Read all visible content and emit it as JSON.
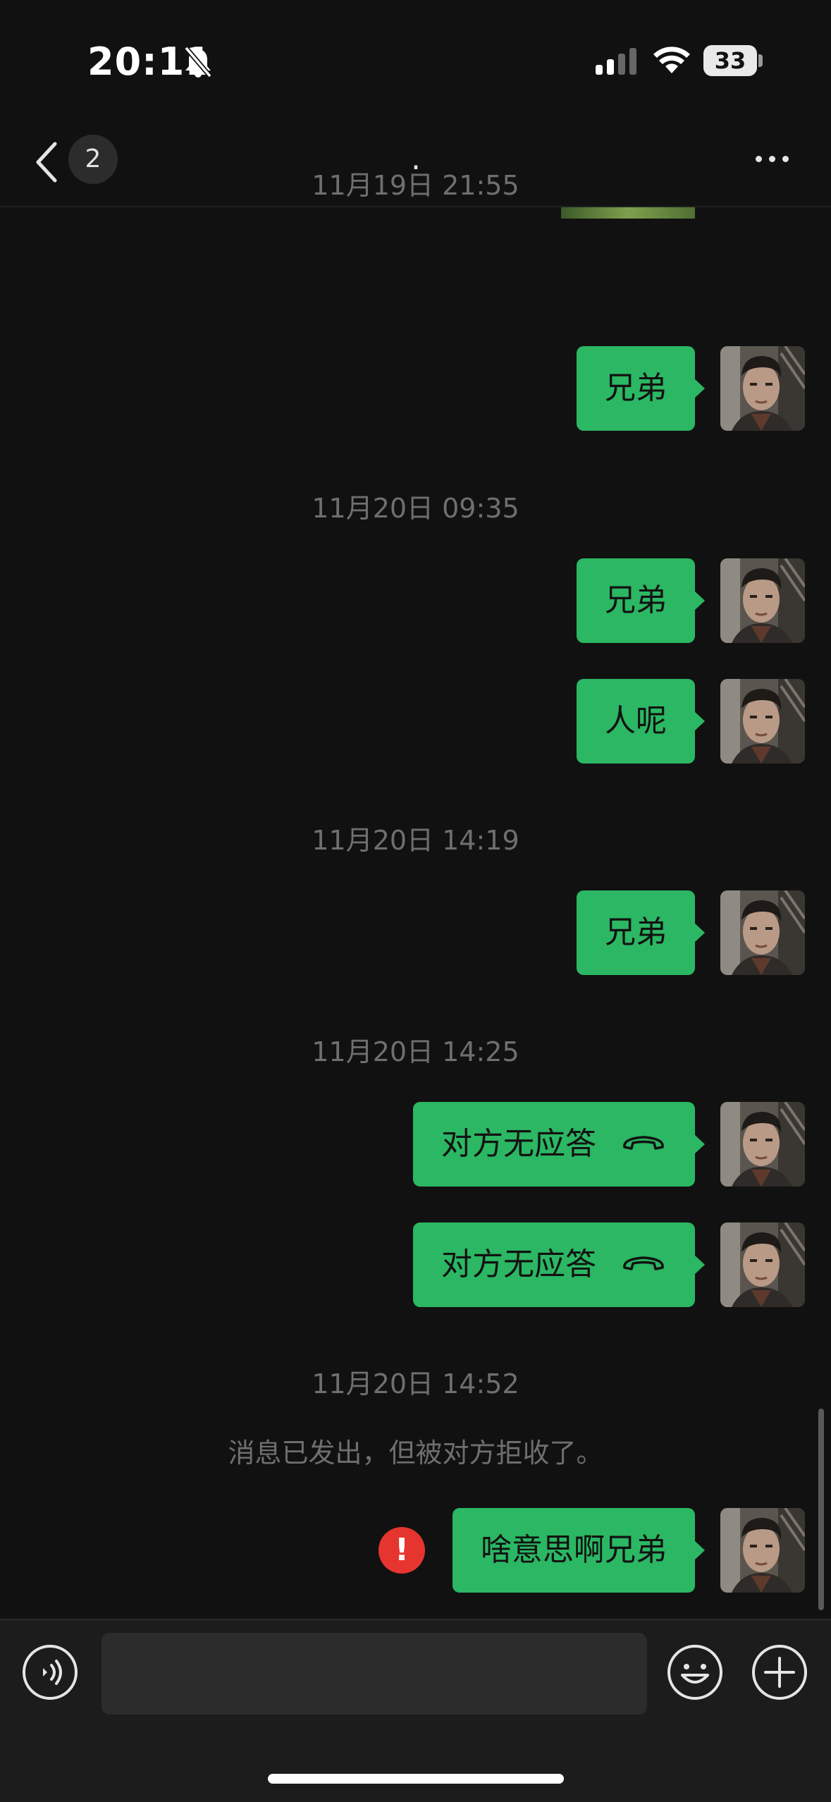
{
  "status_bar": {
    "time": "20:11",
    "battery": "33"
  },
  "nav": {
    "unread_count": "2",
    "title": "."
  },
  "chat": {
    "timestamps": [
      "11月19日 21:55",
      "11月20日 09:35",
      "11月20日 14:19",
      "11月20日 14:25",
      "11月20日 14:52"
    ],
    "messages": [
      {
        "text": "兄弟"
      },
      {
        "text": "兄弟"
      },
      {
        "text": "人呢"
      },
      {
        "text": "兄弟"
      },
      {
        "text": "对方无应答",
        "icon": "phone-hangup-icon"
      },
      {
        "text": "对方无应答",
        "icon": "phone-hangup-icon"
      },
      {
        "text": "啥意思啊兄弟",
        "status": "failed"
      }
    ],
    "system_notice": "消息已发出，但被对方拒收了。",
    "error_mark": "!"
  },
  "colors": {
    "bubble": "#2bb763",
    "background": "#111111",
    "error": "#e6352f"
  }
}
